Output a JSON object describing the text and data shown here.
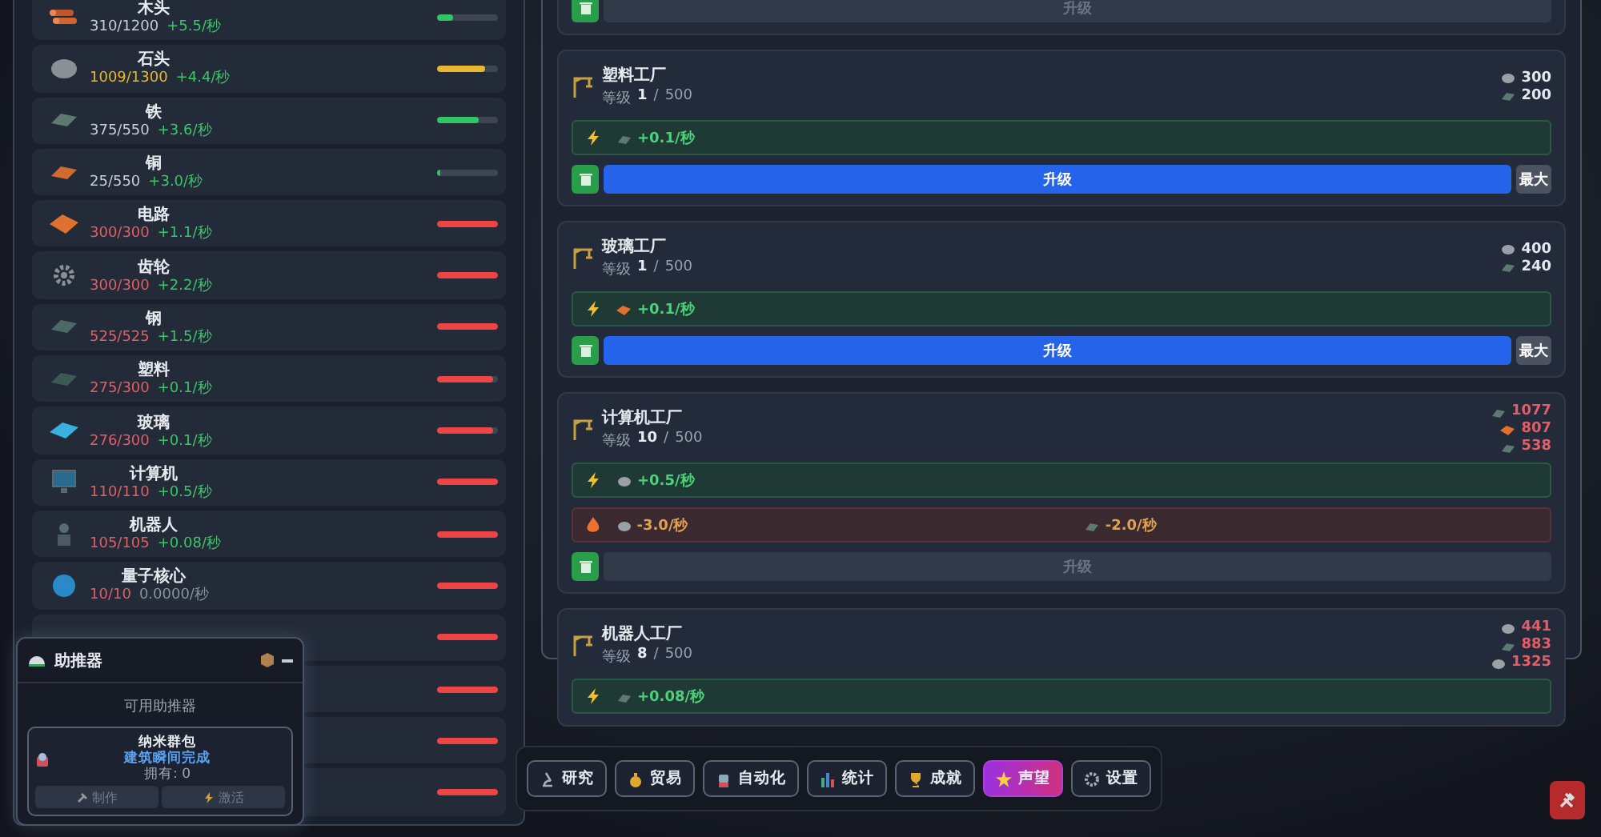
{
  "resources": [
    {
      "name": "木头",
      "amount": "310/1200",
      "rate": "+5.5/秒",
      "warning": false,
      "alert": false,
      "rate_active": true,
      "level": 0.26
    },
    {
      "name": "石头",
      "amount": "1009/1300",
      "rate": "+4.4/秒",
      "warning": true,
      "alert": false,
      "rate_active": true,
      "level": 0.78
    },
    {
      "name": "铁",
      "amount": "375/550",
      "rate": "+3.6/秒",
      "warning": false,
      "alert": false,
      "rate_active": true,
      "level": 0.68
    },
    {
      "name": "铜",
      "amount": "25/550",
      "rate": "+3.0/秒",
      "warning": false,
      "alert": false,
      "rate_active": true,
      "level": 0.05
    },
    {
      "name": "电路",
      "amount": "300/300",
      "rate": "+1.1/秒",
      "warning": false,
      "alert": true,
      "rate_active": true,
      "level": 1
    },
    {
      "name": "齿轮",
      "amount": "300/300",
      "rate": "+2.2/秒",
      "warning": false,
      "alert": true,
      "rate_active": true,
      "level": 1
    },
    {
      "name": "钢",
      "amount": "525/525",
      "rate": "+1.5/秒",
      "warning": false,
      "alert": true,
      "rate_active": true,
      "level": 1
    },
    {
      "name": "塑料",
      "amount": "275/300",
      "rate": "+0.1/秒",
      "warning": false,
      "alert": true,
      "rate_active": true,
      "level": 0.92
    },
    {
      "name": "玻璃",
      "amount": "276/300",
      "rate": "+0.1/秒",
      "warning": false,
      "alert": true,
      "rate_active": true,
      "level": 0.92
    },
    {
      "name": "计算机",
      "amount": "110/110",
      "rate": "+0.5/秒",
      "warning": false,
      "alert": true,
      "rate_active": true,
      "level": 1
    },
    {
      "name": "机器人",
      "amount": "105/105",
      "rate": "+0.08/秒",
      "warning": false,
      "alert": true,
      "rate_active": true,
      "level": 1
    },
    {
      "name": "量子核心",
      "amount": "10/10",
      "rate": "0.0000/秒",
      "warning": false,
      "alert": true,
      "rate_active": false,
      "level": 1
    },
    {
      "warning": false,
      "alert": true,
      "level": 1
    },
    {
      "warning": false,
      "alert": true,
      "level": 1
    },
    {
      "warning": false,
      "alert": true,
      "level": 1
    },
    {
      "warning": false,
      "alert": true,
      "level": 1
    }
  ],
  "factories": [
    {
      "upgrade": {
        "label": "升级",
        "enabled": false
      }
    },
    {
      "name": "塑料工厂",
      "level_label": "等级",
      "level": "1",
      "level_separator": "/",
      "max_level": "500",
      "costs": [
        {
          "amount": "300",
          "affordable": true
        },
        {
          "amount": "200",
          "affordable": true
        }
      ],
      "production": [
        {
          "rate": "+0.1/秒"
        }
      ],
      "upgrade": {
        "label": "升级",
        "enabled": true
      },
      "max_button": "最大"
    },
    {
      "name": "玻璃工厂",
      "level_label": "等级",
      "level": "1",
      "level_separator": "/",
      "max_level": "500",
      "costs": [
        {
          "amount": "400",
          "affordable": true
        },
        {
          "amount": "240",
          "affordable": true
        }
      ],
      "production": [
        {
          "rate": "+0.1/秒"
        }
      ],
      "upgrade": {
        "label": "升级",
        "enabled": true
      },
      "max_button": "最大"
    },
    {
      "name": "计算机工厂",
      "level_label": "等级",
      "level": "10",
      "level_separator": "/",
      "max_level": "500",
      "costs": [
        {
          "amount": "1077",
          "affordable": false
        },
        {
          "amount": "807",
          "affordable": false
        },
        {
          "amount": "538",
          "affordable": false
        }
      ],
      "production": [
        {
          "rate": "+0.5/秒"
        }
      ],
      "consumption": [
        {
          "rate": "-3.0/秒"
        },
        {
          "rate": "-2.0/秒"
        }
      ],
      "upgrade": {
        "label": "升级",
        "enabled": false
      }
    },
    {
      "name": "机器人工厂",
      "level_label": "等级",
      "level": "8",
      "level_separator": "/",
      "max_level": "500",
      "costs": [
        {
          "amount": "441",
          "affordable": false
        },
        {
          "amount": "883",
          "affordable": false
        },
        {
          "amount": "1325",
          "affordable": false
        }
      ],
      "production": [
        {
          "rate": "+0.08/秒"
        }
      ]
    }
  ],
  "booster": {
    "title": "助推器",
    "subtitle": "可用助推器",
    "items": [
      {
        "name": "纳米群包",
        "description": "建筑瞬间完成",
        "owned": "拥有: 0",
        "buttons": [
          {
            "label": "制作",
            "enabled": false
          },
          {
            "label": "激活",
            "enabled": false
          }
        ]
      }
    ]
  },
  "nav": [
    {
      "label": "研究",
      "selected": false
    },
    {
      "label": "贸易",
      "selected": false
    },
    {
      "label": "自动化",
      "selected": false
    },
    {
      "label": "统计",
      "selected": false
    },
    {
      "label": "成就",
      "selected": false
    },
    {
      "label": "声望",
      "selected": true
    },
    {
      "label": "设置",
      "selected": false
    }
  ]
}
